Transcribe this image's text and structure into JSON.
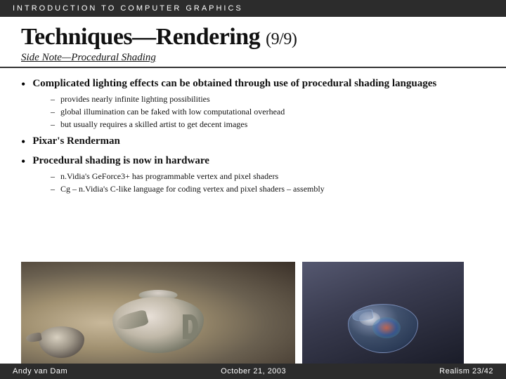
{
  "header": {
    "text": "INTRODUCTION   TO   COMPUTER   GRAPHICS"
  },
  "title": {
    "main": "Techniques—Rendering",
    "page_num": "(9/9)"
  },
  "side_note": {
    "label": "Side Note—Procedural Shading"
  },
  "content": {
    "bullets": [
      {
        "id": "bullet1",
        "text_bold": "Complicated lighting effects can be obtained through use of procedural shading languages",
        "sub_bullets": [
          "provides nearly infinite lighting possibilities",
          "global illumination can be faked with low computational overhead",
          "but usually requires a skilled artist to get decent images"
        ]
      },
      {
        "id": "bullet2",
        "text_bold": "Pixar's Renderman",
        "sub_bullets": []
      },
      {
        "id": "bullet3",
        "text_bold": "Procedural shading is now in hardware",
        "sub_bullets": [
          "n.Vidia's GeForce3+ has programmable vertex and pixel shaders",
          "Cg – n.Vidia's C-like language for coding vertex and pixel shaders – assembly"
        ]
      }
    ]
  },
  "footer": {
    "author": "Andy van Dam",
    "date": "October 21, 2003",
    "right": "Realism   23/42"
  }
}
